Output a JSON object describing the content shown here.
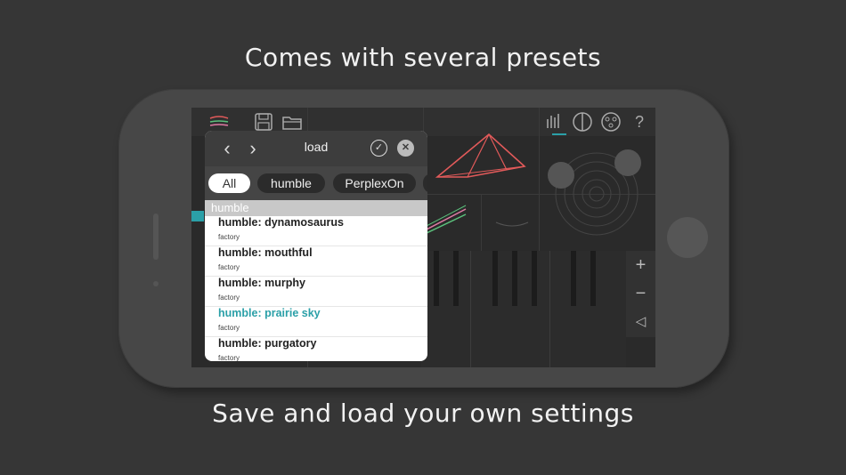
{
  "captions": {
    "top": "Comes with several presets",
    "bottom": "Save and load your own settings"
  },
  "toolbar": {
    "menu_icon": "menu-lines-icon",
    "save_icon": "floppy-icon",
    "folder_icon": "folder-icon",
    "meter_icon": "level-meter-icon",
    "split_icon": "split-circle-icon",
    "dots_icon": "dots-circle-icon",
    "help_label": "?"
  },
  "side_controls": {
    "plus": "+",
    "minus": "−",
    "back": "◁"
  },
  "dialog": {
    "prev": "‹",
    "next": "›",
    "title": "load",
    "confirm": "✓",
    "close": "✕",
    "filters": [
      "All",
      "humble",
      "PerplexOn"
    ],
    "active_filter": "All",
    "section": "humble",
    "items": [
      {
        "name": "humble: dynamosaurus",
        "sub": "factory"
      },
      {
        "name": "humble: mouthful",
        "sub": "factory"
      },
      {
        "name": "humble: murphy",
        "sub": "factory"
      },
      {
        "name": "humble: prairie sky",
        "sub": "factory"
      },
      {
        "name": "humble: purgatory",
        "sub": "factory"
      }
    ],
    "highlighted_index": 3
  },
  "colors": {
    "accent": "#2ba0a8",
    "shape_red": "#e25a5a",
    "shape_green": "#5bc07c",
    "shape_pink": "#e07aa5"
  }
}
